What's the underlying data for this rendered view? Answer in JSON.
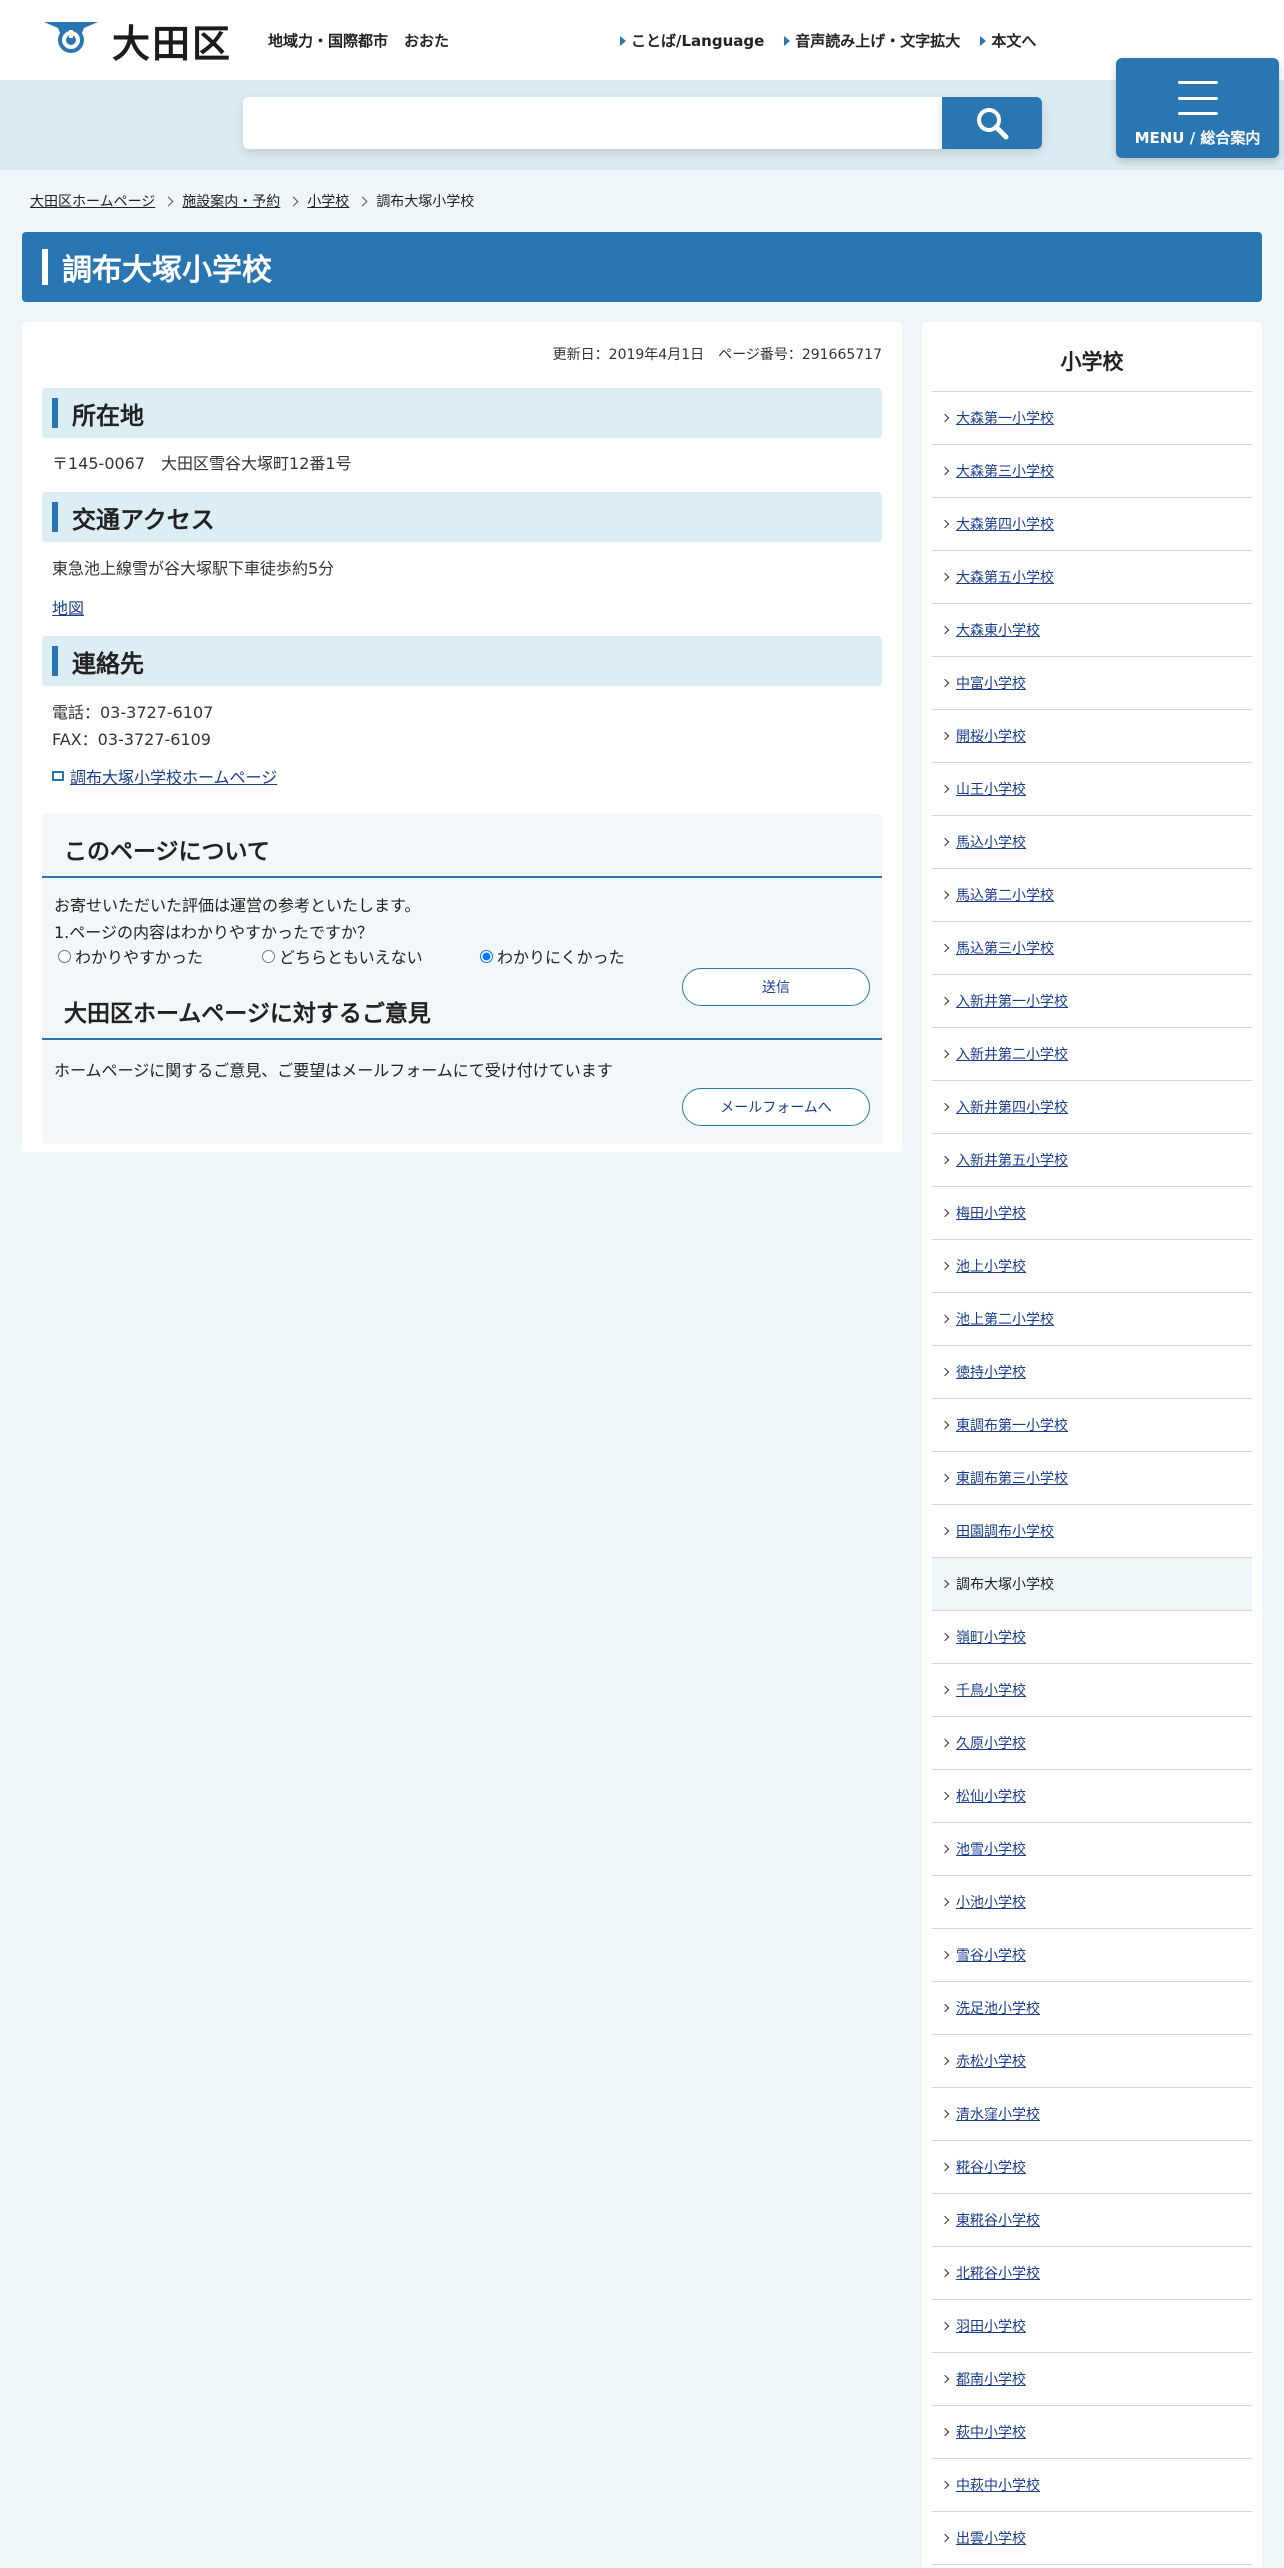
{
  "header": {
    "logo_text": "大田区",
    "tagline_1": "地域力・国際都市",
    "tagline_2": "おおた",
    "links": [
      "ことば/Language",
      "音声読み上げ・文字拡大",
      "本文へ"
    ]
  },
  "search": {
    "placeholder": "",
    "button_icon": "search-icon"
  },
  "menu": {
    "label": "MENU / 総合案内",
    "icon": "hamburger-icon"
  },
  "breadcrumb": [
    "大田区ホームページ",
    "施設案内・予約",
    "小学校",
    "調布大塚小学校"
  ],
  "page": {
    "title": "調布大塚小学校",
    "updated": "更新日：2019年4月1日　ページ番号：291665717",
    "location_heading": "所在地",
    "address": "〒145-0067　大田区雪谷大塚町12番1号",
    "access_heading": "交通アクセス",
    "access_text": "東急池上線雪が谷大塚駅下車徒歩約5分",
    "map_link": "地図",
    "contact_heading": "連絡先",
    "phone": "電話：03-3727-6107",
    "fax": "FAX：03-3727-6109",
    "homepage_link": "調布大塚小学校ホームページ"
  },
  "survey": {
    "heading": "このページについて",
    "intro": "お寄せいただいた評価は運営の参考といたします。",
    "question": "1.ページの内容はわかりやすかったですか？",
    "options": [
      "わかりやすかった",
      "どちらともいえない",
      "わかりにくかった"
    ],
    "selected_index": 2,
    "submit": "送信",
    "opinion_heading": "大田区ホームページに対するご意見",
    "opinion_text": "ホームページに関するご意見、ご要望はメールフォームにて受け付けています",
    "mail_button": "メールフォームへ"
  },
  "sidebar": {
    "title": "小学校",
    "current_index": 22,
    "items": [
      "大森第一小学校",
      "大森第三小学校",
      "大森第四小学校",
      "大森第五小学校",
      "大森東小学校",
      "中富小学校",
      "開桜小学校",
      "山王小学校",
      "馬込小学校",
      "馬込第二小学校",
      "馬込第三小学校",
      "入新井第一小学校",
      "入新井第二小学校",
      "入新井第四小学校",
      "入新井第五小学校",
      "梅田小学校",
      "池上小学校",
      "池上第二小学校",
      "徳持小学校",
      "東調布第一小学校",
      "東調布第三小学校",
      "田園調布小学校",
      "調布大塚小学校",
      "嶺町小学校",
      "千鳥小学校",
      "久原小学校",
      "松仙小学校",
      "池雪小学校",
      "小池小学校",
      "雪谷小学校",
      "洗足池小学校",
      "赤松小学校",
      "清水窪小学校",
      "糀谷小学校",
      "東糀谷小学校",
      "北糀谷小学校",
      "羽田小学校",
      "都南小学校",
      "萩中小学校",
      "中萩中小学校",
      "出雲小学校"
    ]
  }
}
